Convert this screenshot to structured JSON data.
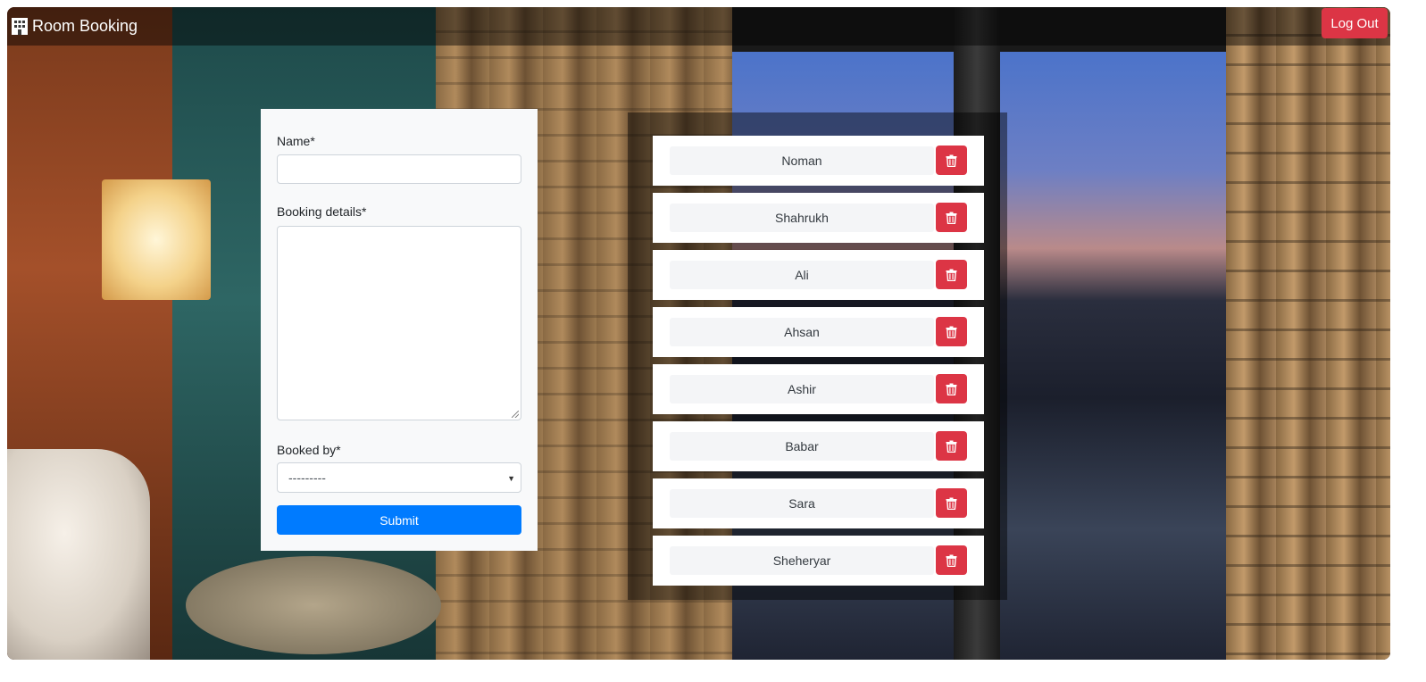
{
  "navbar": {
    "brand_icon": "hotel-icon",
    "brand_label": "Room Booking",
    "logout_label": "Log Out",
    "logout_color": "#dc3545"
  },
  "form": {
    "name_label": "Name*",
    "name_value": "",
    "details_label": "Booking details*",
    "details_value": "",
    "booked_by_label": "Booked by*",
    "booked_by_selected": "---------",
    "submit_label": "Submit",
    "submit_color": "#007bff"
  },
  "bookings": {
    "delete_icon": "trash-icon",
    "items": [
      {
        "name": "Noman"
      },
      {
        "name": "Shahrukh"
      },
      {
        "name": "Ali"
      },
      {
        "name": "Ahsan"
      },
      {
        "name": "Ashir"
      },
      {
        "name": "Babar"
      },
      {
        "name": "Sara"
      },
      {
        "name": "Sheheryar"
      }
    ]
  }
}
